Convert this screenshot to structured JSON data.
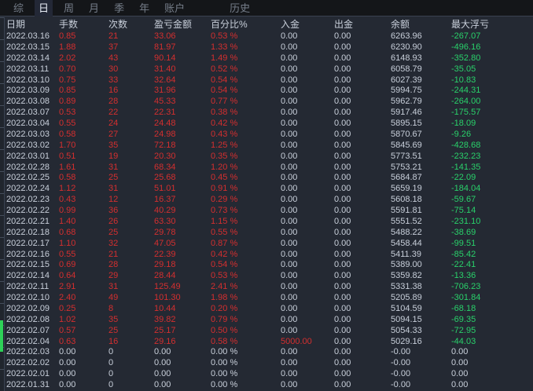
{
  "tab_bar": {
    "tabs": [
      {
        "label": "综",
        "active": false
      },
      {
        "label": "日",
        "active": true
      },
      {
        "label": "周",
        "active": false
      },
      {
        "label": "月",
        "active": false
      },
      {
        "label": "季",
        "active": false
      },
      {
        "label": "年",
        "active": false
      },
      {
        "label": "账户",
        "active": false
      },
      {
        "label": "历史",
        "active": false,
        "history": true
      }
    ]
  },
  "colors": {
    "profit_red": "#d42f2f",
    "loss_green": "#29d16a",
    "neutral_text": "#c8cfda",
    "marker_green": "#2ed158",
    "background": "#242933",
    "tabbar_background": "#141619"
  },
  "table": {
    "columns": [
      "日期",
      "手数",
      "次数",
      "盈亏金额",
      "百分比%",
      "入金",
      "出金",
      "余额",
      "最大浮亏"
    ],
    "rows": [
      [
        "2022.03.16",
        "0.85",
        "21",
        "33.06",
        "0.53 %",
        "0.00",
        "0.00",
        "6263.96",
        "-267.07"
      ],
      [
        "2022.03.15",
        "1.88",
        "37",
        "81.97",
        "1.33 %",
        "0.00",
        "0.00",
        "6230.90",
        "-496.16"
      ],
      [
        "2022.03.14",
        "2.02",
        "43",
        "90.14",
        "1.49 %",
        "0.00",
        "0.00",
        "6148.93",
        "-352.80"
      ],
      [
        "2022.03.11",
        "0.70",
        "30",
        "31.40",
        "0.52 %",
        "0.00",
        "0.00",
        "6058.79",
        "-35.05"
      ],
      [
        "2022.03.10",
        "0.75",
        "33",
        "32.64",
        "0.54 %",
        "0.00",
        "0.00",
        "6027.39",
        "-10.83"
      ],
      [
        "2022.03.09",
        "0.85",
        "16",
        "31.96",
        "0.54 %",
        "0.00",
        "0.00",
        "5994.75",
        "-244.31"
      ],
      [
        "2022.03.08",
        "0.89",
        "28",
        "45.33",
        "0.77 %",
        "0.00",
        "0.00",
        "5962.79",
        "-264.00"
      ],
      [
        "2022.03.07",
        "0.53",
        "22",
        "22.31",
        "0.38 %",
        "0.00",
        "0.00",
        "5917.46",
        "-175.57"
      ],
      [
        "2022.03.04",
        "0.55",
        "24",
        "24.48",
        "0.42 %",
        "0.00",
        "0.00",
        "5895.15",
        "-18.09"
      ],
      [
        "2022.03.03",
        "0.58",
        "27",
        "24.98",
        "0.43 %",
        "0.00",
        "0.00",
        "5870.67",
        "-9.26"
      ],
      [
        "2022.03.02",
        "1.70",
        "35",
        "72.18",
        "1.25 %",
        "0.00",
        "0.00",
        "5845.69",
        "-428.68"
      ],
      [
        "2022.03.01",
        "0.51",
        "19",
        "20.30",
        "0.35 %",
        "0.00",
        "0.00",
        "5773.51",
        "-232.23"
      ],
      [
        "2022.02.28",
        "1.61",
        "31",
        "68.34",
        "1.20 %",
        "0.00",
        "0.00",
        "5753.21",
        "-141.35"
      ],
      [
        "2022.02.25",
        "0.58",
        "25",
        "25.68",
        "0.45 %",
        "0.00",
        "0.00",
        "5684.87",
        "-22.09"
      ],
      [
        "2022.02.24",
        "1.12",
        "31",
        "51.01",
        "0.91 %",
        "0.00",
        "0.00",
        "5659.19",
        "-184.04"
      ],
      [
        "2022.02.23",
        "0.43",
        "12",
        "16.37",
        "0.29 %",
        "0.00",
        "0.00",
        "5608.18",
        "-59.67"
      ],
      [
        "2022.02.22",
        "0.99",
        "36",
        "40.29",
        "0.73 %",
        "0.00",
        "0.00",
        "5591.81",
        "-75.14"
      ],
      [
        "2022.02.21",
        "1.40",
        "26",
        "63.30",
        "1.15 %",
        "0.00",
        "0.00",
        "5551.52",
        "-231.10"
      ],
      [
        "2022.02.18",
        "0.68",
        "25",
        "29.78",
        "0.55 %",
        "0.00",
        "0.00",
        "5488.22",
        "-38.69"
      ],
      [
        "2022.02.17",
        "1.10",
        "32",
        "47.05",
        "0.87 %",
        "0.00",
        "0.00",
        "5458.44",
        "-99.51"
      ],
      [
        "2022.02.16",
        "0.55",
        "21",
        "22.39",
        "0.42 %",
        "0.00",
        "0.00",
        "5411.39",
        "-85.42"
      ],
      [
        "2022.02.15",
        "0.69",
        "28",
        "29.18",
        "0.54 %",
        "0.00",
        "0.00",
        "5389.00",
        "-22.41"
      ],
      [
        "2022.02.14",
        "0.64",
        "29",
        "28.44",
        "0.53 %",
        "0.00",
        "0.00",
        "5359.82",
        "-13.36"
      ],
      [
        "2022.02.11",
        "2.91",
        "31",
        "125.49",
        "2.41 %",
        "0.00",
        "0.00",
        "5331.38",
        "-706.23"
      ],
      [
        "2022.02.10",
        "2.40",
        "49",
        "101.30",
        "1.98 %",
        "0.00",
        "0.00",
        "5205.89",
        "-301.84"
      ],
      [
        "2022.02.09",
        "0.25",
        "8",
        "10.44",
        "0.20 %",
        "0.00",
        "0.00",
        "5104.59",
        "-68.18"
      ],
      [
        "2022.02.08",
        "1.02",
        "35",
        "39.82",
        "0.79 %",
        "0.00",
        "0.00",
        "5094.15",
        "-69.35"
      ],
      [
        "2022.02.07",
        "0.57",
        "25",
        "25.17",
        "0.50 %",
        "0.00",
        "0.00",
        "5054.33",
        "-72.95"
      ],
      [
        "2022.02.04",
        "0.63",
        "16",
        "29.16",
        "0.58 %",
        "5000.00",
        "0.00",
        "5029.16",
        "-44.03"
      ],
      [
        "2022.02.03",
        "0.00",
        "0",
        "0.00",
        "0.00 %",
        "0.00",
        "0.00",
        "-0.00",
        "0.00"
      ],
      [
        "2022.02.02",
        "0.00",
        "0",
        "0.00",
        "0.00 %",
        "0.00",
        "0.00",
        "-0.00",
        "0.00"
      ],
      [
        "2022.02.01",
        "0.00",
        "0",
        "0.00",
        "0.00 %",
        "0.00",
        "0.00",
        "-0.00",
        "0.00"
      ],
      [
        "2022.01.31",
        "0.00",
        "0",
        "0.00",
        "0.00 %",
        "0.00",
        "0.00",
        "-0.00",
        "0.00"
      ]
    ]
  }
}
